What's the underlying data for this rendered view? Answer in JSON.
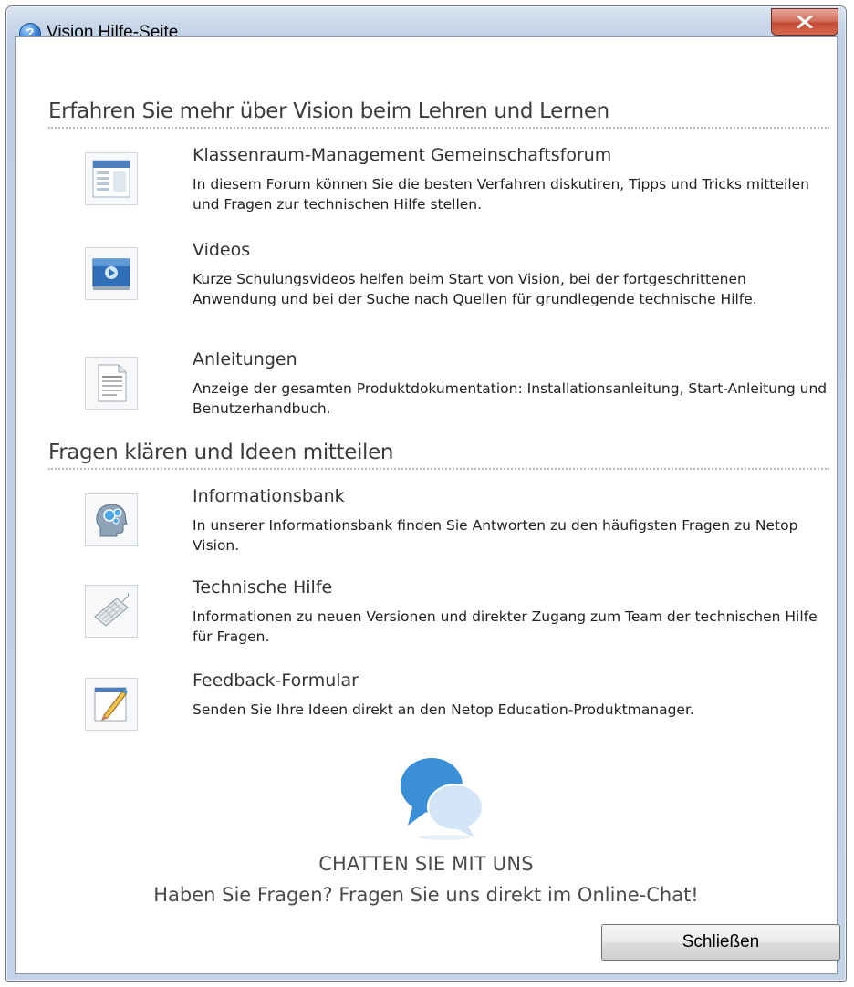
{
  "window": {
    "title": "Vision  Hilfe-Seite"
  },
  "sections": [
    {
      "heading": "Erfahren Sie mehr über Vision beim Lehren und Lernen",
      "items": [
        {
          "icon": "forum-icon",
          "title": "Klassenraum-Management Gemeinschaftsforum",
          "desc": "In diesem Forum können Sie die besten Verfahren diskutiren, Tipps und Tricks mitteilen und Fragen zur technischen Hilfe stellen."
        },
        {
          "icon": "video-icon",
          "title": "Videos",
          "desc": "Kurze Schulungsvideos helfen beim Start von Vision, bei der fortgeschrittenen Anwendung und bei der Suche nach Quellen für grundlegende technische Hilfe."
        },
        {
          "icon": "document-icon",
          "title": "Anleitungen",
          "desc": "Anzeige der gesamten Produktdokumentation: Installationsanleitung, Start-Anleitung und Benutzerhandbuch."
        }
      ]
    },
    {
      "heading": "Fragen klären und Ideen mitteilen",
      "items": [
        {
          "icon": "knowledge-base-icon",
          "title": "Informationsbank",
          "desc": "In unserer Informationsbank finden Sie Antworten zu den häufigsten Fragen zu Netop Vision."
        },
        {
          "icon": "keyboard-icon",
          "title": "Technische Hilfe",
          "desc": "Informationen zu neuen Versionen und direkter Zugang zum Team der technischen Hilfe für Fragen."
        },
        {
          "icon": "feedback-pencil-icon",
          "title": "Feedback-Formular",
          "desc": "Senden Sie Ihre Ideen direkt an den Netop Education-Produktmanager."
        }
      ]
    }
  ],
  "chat": {
    "title": "CHATTEN SIE MIT UNS",
    "subtitle": "Haben Sie Fragen? Fragen Sie uns direkt im Online-Chat!"
  },
  "buttons": {
    "close_label": "Schließen"
  },
  "colors": {
    "titlebar": "#c9d7e8",
    "close_red": "#c24a36",
    "chat_blue": "#3a8fd6"
  }
}
